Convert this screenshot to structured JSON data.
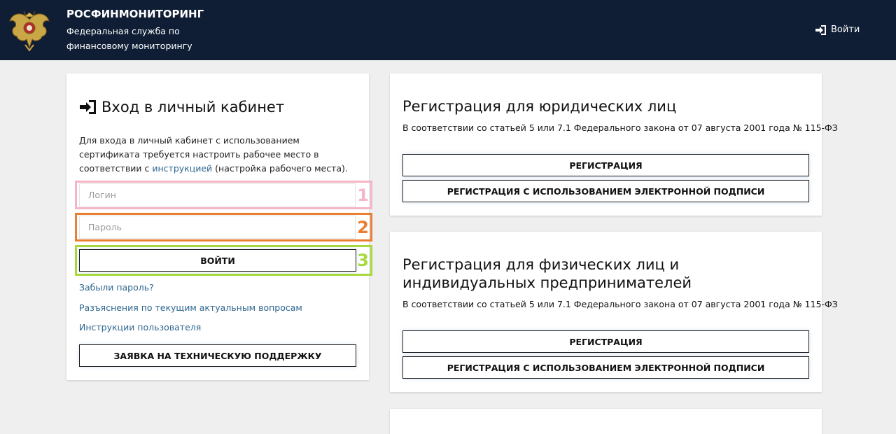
{
  "header": {
    "org_name": "РОСФИНМОНИТОРИНГ",
    "org_sub": "Федеральная служба по финансовому мониторингу",
    "login_label": "Войти"
  },
  "login": {
    "title": "Вход в личный кабинет",
    "intro_before": "Для входа в личный кабинет с использованием сертификата требуется настроить рабочее место в соответствии с ",
    "intro_link": "инструкцией",
    "intro_after": " (настройка рабочего места).",
    "login_placeholder": "Логин",
    "password_placeholder": "Пароль",
    "submit_label": "ВОЙТИ",
    "forgot_password": "Забыли пароль?",
    "faq_link": "Разъяснения по текущим актуальным вопросам",
    "instructions_link": "Инструкции пользователя",
    "support_label": "ЗАЯВКА НА ТЕХНИЧЕСКУЮ ПОДДЕРЖКУ"
  },
  "highlights": [
    "1",
    "2",
    "3"
  ],
  "registration": [
    {
      "title": "Регистрация для юридических лиц",
      "desc": "В соответствии со статьей 5 или 7.1 Федерального закона от 07 августа 2001 года № 115-ФЗ",
      "btn1": "РЕГИСТРАЦИЯ",
      "btn2": "РЕГИСТРАЦИЯ С ИСПОЛЬЗОВАНИЕМ ЭЛЕКТРОННОЙ ПОДПИСИ"
    },
    {
      "title": "Регистрация для физических лиц и индивидуальных предпринимателей",
      "desc": "В соответствии со статьей 5 или 7.1 Федерального закона от 07 августа 2001 года № 115-ФЗ",
      "btn1": "РЕГИСТРАЦИЯ",
      "btn2": "РЕГИСТРАЦИЯ С ИСПОЛЬЗОВАНИЕМ ЭЛЕКТРОННОЙ ПОДПИСИ"
    }
  ],
  "colors": {
    "header_bg": "#0f1e35",
    "link": "#2d6690",
    "highlight_1": "#f4b6c7",
    "highlight_2": "#ea7f31",
    "highlight_3": "#a7d93c"
  },
  "icons": {
    "emblem": "double-headed-eagle-emblem",
    "login": "sign-in-icon"
  }
}
